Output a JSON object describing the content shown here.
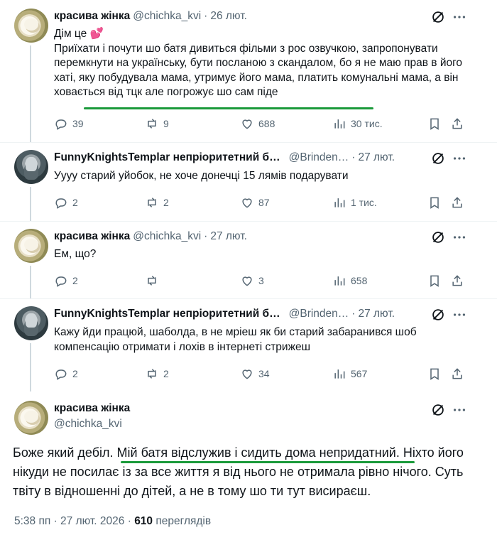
{
  "tweets": [
    {
      "name": "красива жінка",
      "handle": "@chichka_kvi",
      "date": "26 лют.",
      "line1": "Дім це ",
      "emoji": "💕",
      "text": "Приїхати і почути шо батя дивиться фільми з рос озвучкою, запропонувати перемкнути на українську, бути посланою з скандалом, бо я не маю прав в його хаті, яку побудувала мама, утримує його мама, платить комунальні мама, а він ховається від тцк але погрожує шо сам піде",
      "replies": "39",
      "reposts": "9",
      "likes": "688",
      "views": "30 тис."
    },
    {
      "name": "FunnyKnightsTemplar непріоритетний б…",
      "handle": "@Brinden…",
      "date": "27 лют.",
      "text": "Уууу старий уйобок, не хоче донечці 15 лямів подарувати",
      "replies": "2",
      "reposts": "2",
      "likes": "87",
      "views": "1 тис."
    },
    {
      "name": "красива жінка",
      "handle": "@chichka_kvi",
      "date": "27 лют.",
      "text": "Ем, що?",
      "replies": "2",
      "reposts": "",
      "likes": "3",
      "views": "658"
    },
    {
      "name": "FunnyKnightsTemplar непріоритетний б…",
      "handle": "@Brinden…",
      "date": "27 лют.",
      "text": "Кажу йди працюй, шаболда, в не мріеш як би старий забаранився шоб компенсацію отримати і лохів в інтернеті стрижеш",
      "replies": "2",
      "reposts": "2",
      "likes": "34",
      "views": "567"
    }
  ],
  "main": {
    "name": "красива жінка",
    "handle": "@chichka_kvi",
    "text": "Боже який дебіл. Мій батя відслужив і сидить дома непридатний. Ніхто його нікуди не посилає із за все життя я від нього не отримала рівно нічого. Суть твіту в відношенні до дітей, а не в тому шо ти тут висираєш.",
    "time": "5:38 пп",
    "date": "27 лют. 2026",
    "views_count": "610",
    "views_label": "переглядів"
  },
  "colors": {
    "text": "#0f1419",
    "secondary": "#536471",
    "underline": "#1a9a3a",
    "divider": "#eff3f4"
  },
  "icons": [
    "grok-icon",
    "reply-icon",
    "repost-icon",
    "like-icon",
    "views-icon",
    "bookmark-icon",
    "share-icon"
  ]
}
